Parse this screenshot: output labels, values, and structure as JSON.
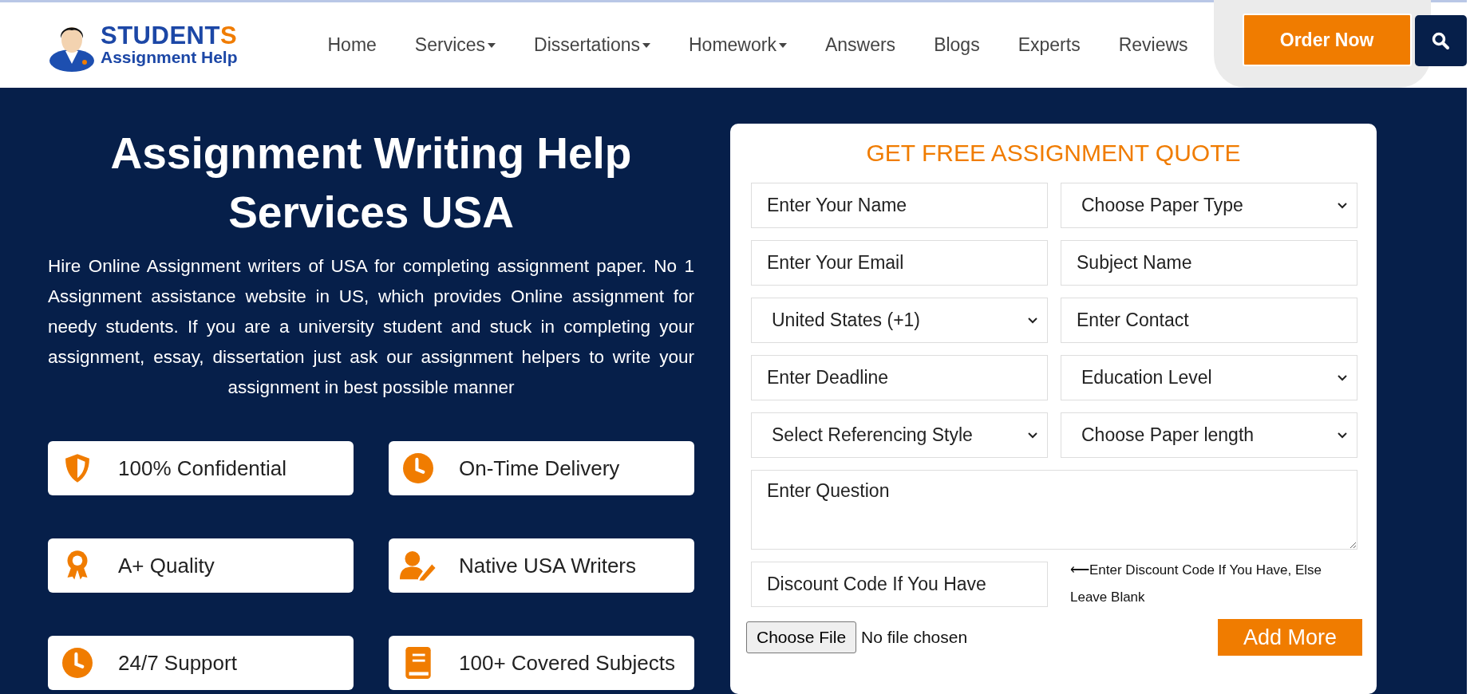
{
  "header": {
    "logo": {
      "title": "STUDENT",
      "title_accent": "S",
      "subtitle": "Assignment Help"
    },
    "nav": [
      {
        "label": "Home",
        "dropdown": false
      },
      {
        "label": "Services",
        "dropdown": true
      },
      {
        "label": "Dissertations",
        "dropdown": true
      },
      {
        "label": "Homework",
        "dropdown": true
      },
      {
        "label": "Answers",
        "dropdown": false
      },
      {
        "label": "Blogs",
        "dropdown": false
      },
      {
        "label": "Experts",
        "dropdown": false
      },
      {
        "label": "Reviews",
        "dropdown": false
      }
    ],
    "order_button": "Order Now"
  },
  "hero": {
    "title": "Assignment Writing Help Services USA",
    "description": "Hire Online Assignment writers of USA for completing assignment paper. No 1 Assignment assistance website in US, which provides Online assignment for needy students. If you are a university student and stuck in completing your assignment, essay, dissertation just ask our assignment helpers to write your assignment in best possible manner",
    "features": [
      {
        "label": "100% Confidential",
        "kind": "shield"
      },
      {
        "label": "On-Time Delivery",
        "kind": "clock"
      },
      {
        "label": "A+ Quality",
        "kind": "award"
      },
      {
        "label": "Native USA Writers",
        "kind": "writer"
      },
      {
        "label": "24/7 Support",
        "kind": "clock"
      },
      {
        "label": "100+ Covered Subjects",
        "kind": "book"
      }
    ]
  },
  "quote_form": {
    "title": "GET FREE ASSIGNMENT QUOTE",
    "fields": [
      {
        "kind": "input",
        "placeholder": "Enter Your Name"
      },
      {
        "kind": "select",
        "value": "Choose Paper Type"
      },
      {
        "kind": "input",
        "placeholder": "Enter Your Email"
      },
      {
        "kind": "input",
        "placeholder": "Subject Name"
      },
      {
        "kind": "select",
        "value": "United States (+1)"
      },
      {
        "kind": "input",
        "placeholder": "Enter Contact"
      },
      {
        "kind": "input",
        "placeholder": "Enter Deadline"
      },
      {
        "kind": "select",
        "value": "Education Level"
      },
      {
        "kind": "select",
        "value": "Select Referencing Style"
      },
      {
        "kind": "select",
        "value": "Choose Paper length"
      }
    ],
    "question": {
      "placeholder": "Enter Question"
    },
    "discount": {
      "placeholder": "Discount Code If You Have",
      "hint": "⟵Enter Discount Code If You Have, Else Leave Blank"
    },
    "file_button": "Choose File",
    "file_status": "No file chosen",
    "add_button": "Add More"
  }
}
